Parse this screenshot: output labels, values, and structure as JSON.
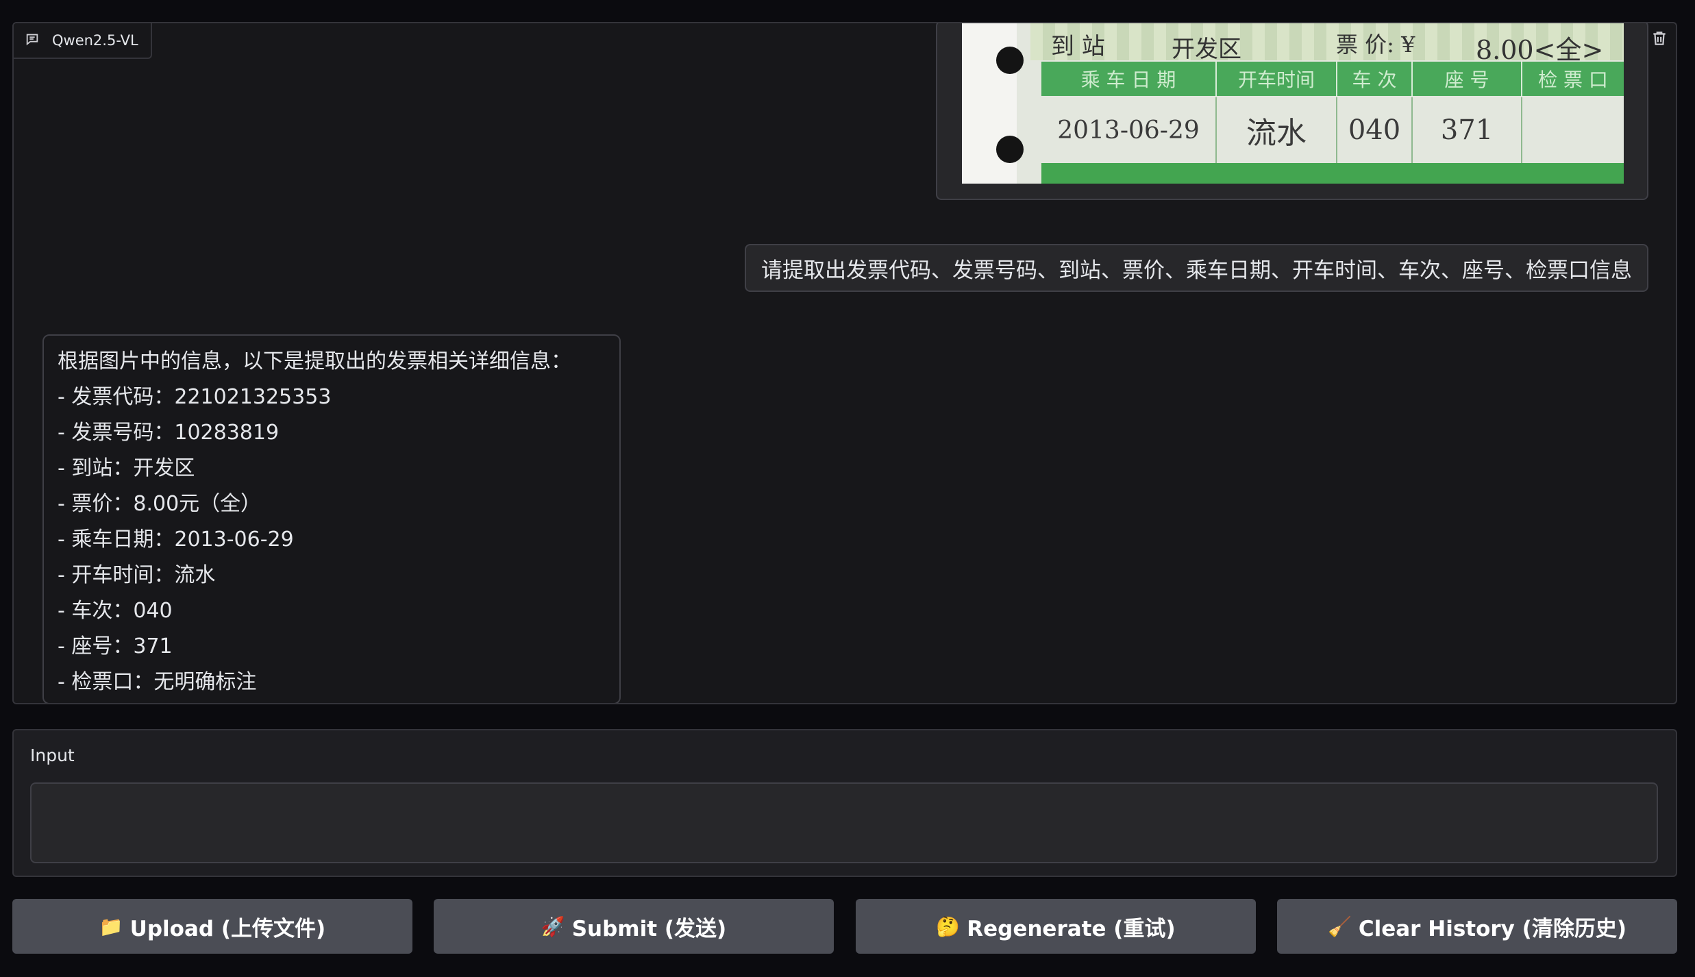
{
  "chatbot": {
    "label": "Qwen2.5-VL",
    "label_icon": "chat-icon",
    "clear_icon": "trash-icon"
  },
  "ticket_image": {
    "dest_label": "到 站",
    "dest_value": "开发区",
    "price_label": "票 价: ¥",
    "price_value": "8.00<全>",
    "headers": [
      "乘 车 日 期",
      "开车时间",
      "车 次",
      "座 号",
      "检 票 口"
    ],
    "values": [
      "2013-06-29",
      "流水",
      "040",
      "371",
      ""
    ]
  },
  "messages": {
    "user_text": "请提取出发票代码、发票号码、到站、票价、乘车日期、开车时间、车次、座号、检票口信息",
    "bot_lines": [
      "根据图片中的信息，以下是提取出的发票相关详细信息：",
      "- 发票代码：221021325353",
      "- 发票号码：10283819",
      "- 到站：开发区",
      "- 票价：8.00元（全）",
      "- 乘车日期：2013-06-29",
      "- 开车时间：流水",
      "- 车次：040",
      "- 座号：371",
      "- 检票口：无明确标注"
    ]
  },
  "input": {
    "label": "Input",
    "value": "",
    "placeholder": ""
  },
  "buttons": {
    "upload": {
      "emoji": "📁",
      "label": "Upload (上传文件)"
    },
    "submit": {
      "emoji": "🚀",
      "label": "Submit (发送)"
    },
    "regenerate": {
      "emoji": "🤔",
      "label": "Regenerate (重试)"
    },
    "clear": {
      "emoji": "🧹",
      "label": "Clear History (清除历史)"
    }
  },
  "colors": {
    "background": "#0b0b0f",
    "panel": "#17171a",
    "bubble": "#27272a",
    "button": "#4b4d55",
    "ticket_green": "#49a85a"
  }
}
